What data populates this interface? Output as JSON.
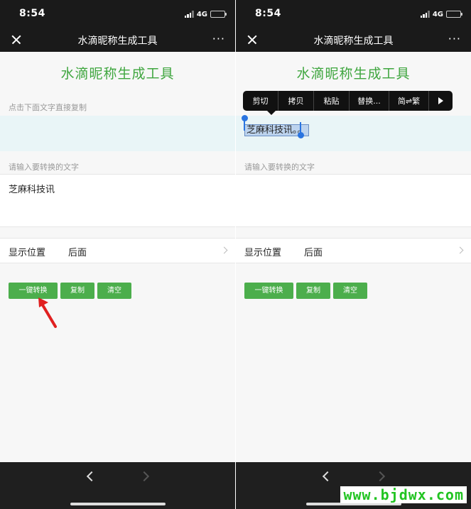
{
  "status_bar": {
    "time": "8:54",
    "network": "4G"
  },
  "nav": {
    "title": "水滴昵称生成工具",
    "more": "···"
  },
  "page": {
    "title": "水滴昵称生成工具",
    "copy_hint": "点击下面文字直接复制",
    "input_hint": "请输入要转换的文字",
    "input_value": "芝麻科技讯",
    "result_text": "芝麻科技讯。。",
    "position_label": "显示位置",
    "position_value": "后面"
  },
  "buttons": {
    "convert": "一键转换",
    "copy": "复制",
    "clear": "清空"
  },
  "context_menu": {
    "items": [
      "剪切",
      "拷贝",
      "粘贴",
      "替换...",
      "简⇌繁"
    ]
  },
  "watermark": "www.bjdwx.com",
  "colors": {
    "accent_green": "#3fa63f",
    "button_green": "#4cae4c",
    "arrow_red": "#e02020",
    "selection_blue": "#2a74e0"
  }
}
